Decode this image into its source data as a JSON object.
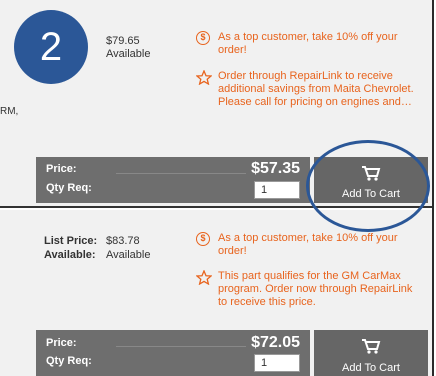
{
  "badge": {
    "number": "2"
  },
  "item1": {
    "price": "$79.65",
    "availability": "Available",
    "truncated_left_text": "RM,",
    "promo_top_customer": "As a top customer, take 10% off your order!",
    "promo_order_through_line1": "Order through RepairLink to receive",
    "promo_order_through_line2": "additional savings from Maita Chevrolet.",
    "promo_order_through_line3": "Please call for pricing on engines and…",
    "price_label": "Price:",
    "price_value": "$57.35",
    "qty_label": "Qty Req:",
    "qty_value": "1",
    "add_to_cart": "Add To Cart"
  },
  "item2": {
    "list_price_label": "List Price:",
    "list_price_value": "$83.78",
    "available_label": "Available:",
    "available_value": "Available",
    "promo_top_customer_line1": "As a top customer, take 10% off your",
    "promo_top_customer_line2": "order!",
    "promo_carmax_line1": "This part qualifies for the GM CarMax",
    "promo_carmax_line2": "program. Order now through RepairLink",
    "promo_carmax_line3": "to receive this price.",
    "price_label": "Price:",
    "price_value": "$72.05",
    "qty_label": "Qty Req:",
    "qty_value": "1",
    "add_to_cart": "Add To Cart"
  },
  "colors": {
    "accent_orange": "#e8641e",
    "badge_blue": "#2b5797",
    "bar_gray": "#6e6e6e"
  },
  "icons": [
    "dollar-circle-icon",
    "star-outline-icon",
    "shopping-cart-icon"
  ]
}
